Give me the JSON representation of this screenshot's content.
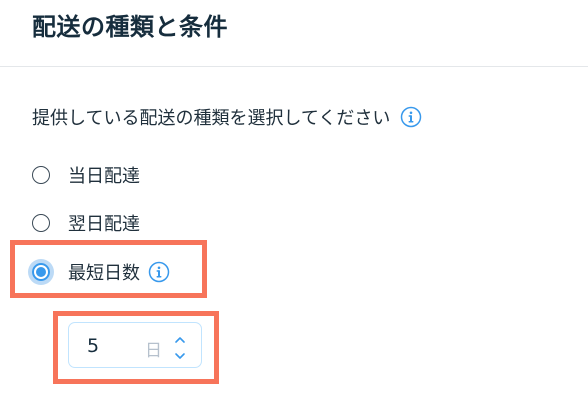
{
  "header": {
    "title": "配送の種類と条件"
  },
  "question": {
    "text": "提供している配送の種類を選択してください",
    "info_icon": "info-icon"
  },
  "options": [
    {
      "label": "当日配達",
      "selected": false
    },
    {
      "label": "翌日配達",
      "selected": false
    },
    {
      "label": "最短日数",
      "selected": true,
      "info_icon": "info-icon"
    }
  ],
  "stepper": {
    "value": "5",
    "unit": "日",
    "up_icon": "chevron-up-icon",
    "down_icon": "chevron-down-icon"
  },
  "colors": {
    "accent": "#3899ec",
    "highlight": "#f7745a",
    "text": "#20303c",
    "divider": "#e4e7ea"
  }
}
